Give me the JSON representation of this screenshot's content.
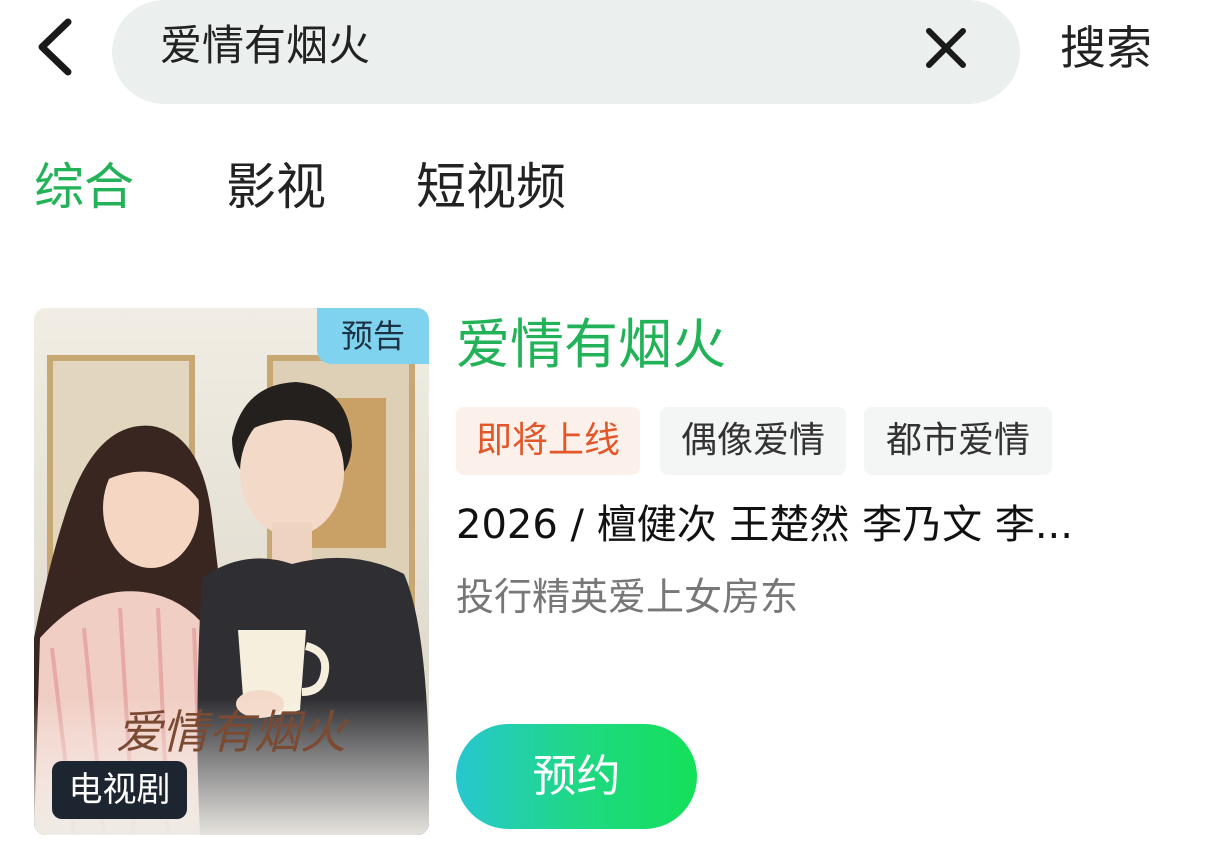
{
  "search": {
    "query": "爱情有烟火",
    "button_label": "搜索"
  },
  "tabs": [
    {
      "label": "综合",
      "active": true
    },
    {
      "label": "影视",
      "active": false
    },
    {
      "label": "短视频",
      "active": false
    }
  ],
  "result": {
    "title": "爱情有烟火",
    "poster": {
      "corner_badge": "预告",
      "type_badge": "电视剧",
      "title_art": "爱情有烟火"
    },
    "tags": [
      "即将上线",
      "偶像爱情",
      "都市爱情"
    ],
    "meta": "2026 / 檀健次  王楚然  李乃文  李...",
    "description": "投行精英爱上女房东",
    "action_label": "预约"
  },
  "colors": {
    "accent": "#22b358",
    "status_tag": "#e2572a",
    "preview_badge": "#7fd3ef"
  },
  "icons": {
    "back": "chevron-left-icon",
    "clear": "close-icon"
  }
}
